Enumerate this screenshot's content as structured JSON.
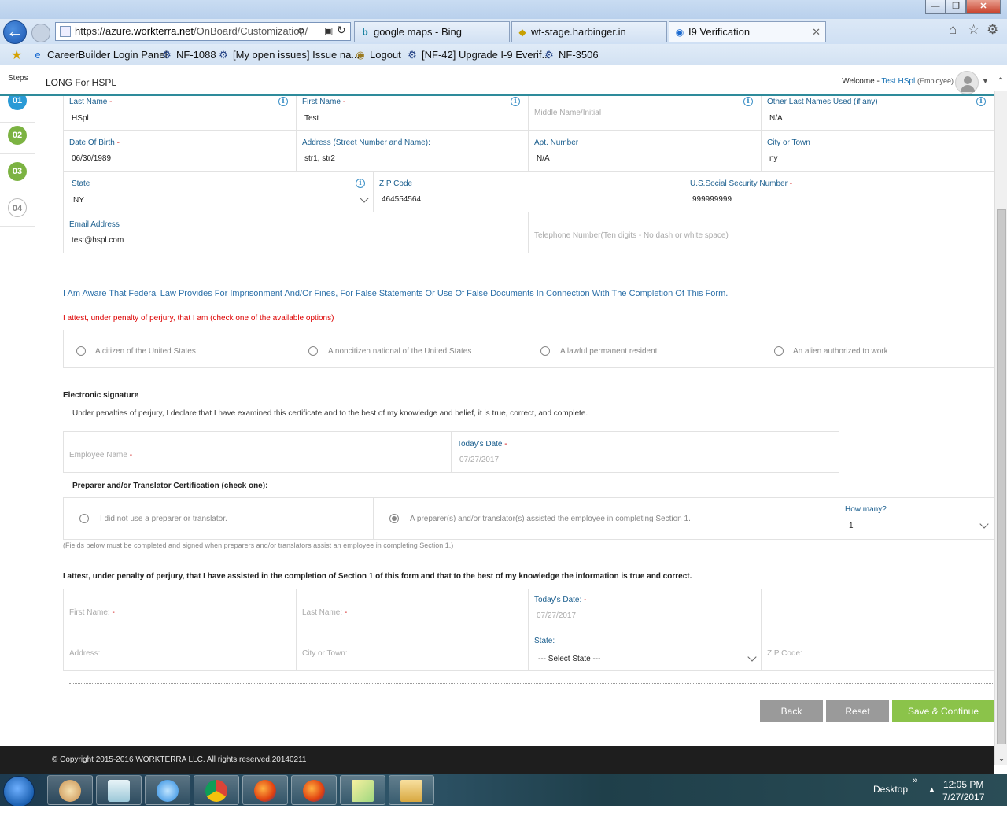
{
  "browser": {
    "url_scheme": "https://azure.",
    "url_domain": "workterra.net",
    "url_path": "/OnBoard/Customization/",
    "tabs": [
      {
        "label": "google maps - Bing",
        "icon": "bing-icon"
      },
      {
        "label": "wt-stage.harbinger.in",
        "icon": "page-icon"
      },
      {
        "label": "I9 Verification",
        "icon": "ie-page-icon",
        "active": true
      }
    ],
    "favorites": [
      "CareerBuilder Login Panel",
      "NF-1088",
      "[My open issues] Issue na...",
      "Logout",
      "[NF-42] Upgrade I-9 Everif...",
      "NF-3506"
    ]
  },
  "app": {
    "steps_label": "Steps",
    "title": "LONG For HSPL",
    "welcome_prefix": "Welcome -",
    "user_name": "Test HSpl",
    "user_role": "(Employee)",
    "steps": [
      {
        "num": "01",
        "color": "#2a9ad6"
      },
      {
        "num": "02",
        "color": "#7cb342"
      },
      {
        "num": "03",
        "color": "#7cb342"
      },
      {
        "num": "04",
        "color": "#ffffff"
      }
    ]
  },
  "form": {
    "last_name": {
      "label": "Last Name",
      "value": "HSpl"
    },
    "first_name": {
      "label": "First Name",
      "value": "Test"
    },
    "middle_name": {
      "label": "Middle Name/Initial"
    },
    "other_names": {
      "label": "Other Last Names Used (if any)",
      "value": "N/A"
    },
    "dob": {
      "label": "Date Of Birth",
      "value": "06/30/1989"
    },
    "address": {
      "label": "Address (Street Number and Name):",
      "value": "str1, str2"
    },
    "apt": {
      "label": "Apt. Number",
      "value": "N/A"
    },
    "city": {
      "label": "City or Town",
      "value": "ny"
    },
    "state": {
      "label": "State",
      "value": "NY"
    },
    "zip": {
      "label": "ZIP Code",
      "value": "464554564"
    },
    "ssn": {
      "label": "U.S.Social Security Number",
      "value": "999999999"
    },
    "email": {
      "label": "Email Address",
      "value": "test@hspl.com"
    },
    "phone": {
      "label": "Telephone Number(Ten digits - No dash or white space)"
    },
    "aware_text": "I Am Aware That Federal Law Provides For Imprisonment And/Or Fines, For False Statements Or Use Of False Documents In Connection With The Completion Of This Form.",
    "attest_text": "I attest, under penalty of perjury, that I am (check one of the available options)",
    "status_options": [
      "A citizen of the United States",
      "A noncitizen national of the United States",
      "A lawful permanent resident",
      "An alien authorized to work"
    ],
    "esig_title": "Electronic signature",
    "esig_text": "Under penalties of perjury, I declare that I have examined this certificate and to the best of my knowledge and belief, it is true, correct, and complete.",
    "employee_name": {
      "label": "Employee Name"
    },
    "todays_date": {
      "label": "Today's Date",
      "value": "07/27/2017"
    },
    "preparer_title": "Preparer and/or Translator Certification (check one):",
    "preparer_options": [
      "I did not use a preparer or translator.",
      "A preparer(s) and/or translator(s) assisted the employee in completing Section 1."
    ],
    "how_many": {
      "label": "How many?",
      "value": "1"
    },
    "fields_note": "(Fields below must be completed and signed when preparers and/or translators assist an employee in completing Section 1.)",
    "preparer_attest": "I attest, under penalty of perjury, that I have assisted in the completion of Section 1 of this form and that to the best of my knowledge the information is true and correct.",
    "prep_first_name": {
      "label": "First Name:"
    },
    "prep_last_name": {
      "label": "Last Name:"
    },
    "prep_date": {
      "label": "Today's Date:",
      "value": "07/27/2017"
    },
    "prep_address": {
      "label": "Address:"
    },
    "prep_city": {
      "label": "City or Town:"
    },
    "prep_state": {
      "label": "State:",
      "value": "--- Select State ---"
    },
    "prep_zip": {
      "label": "ZIP Code:"
    }
  },
  "buttons": {
    "back": "Back",
    "reset": "Reset",
    "save": "Save & Continue"
  },
  "footer": {
    "copyright": "© Copyright 2015-2016 WORKTERRA LLC. All rights reserved.20140211"
  },
  "taskbar": {
    "desktop": "Desktop",
    "time": "12:05 PM",
    "date": "7/27/2017"
  }
}
